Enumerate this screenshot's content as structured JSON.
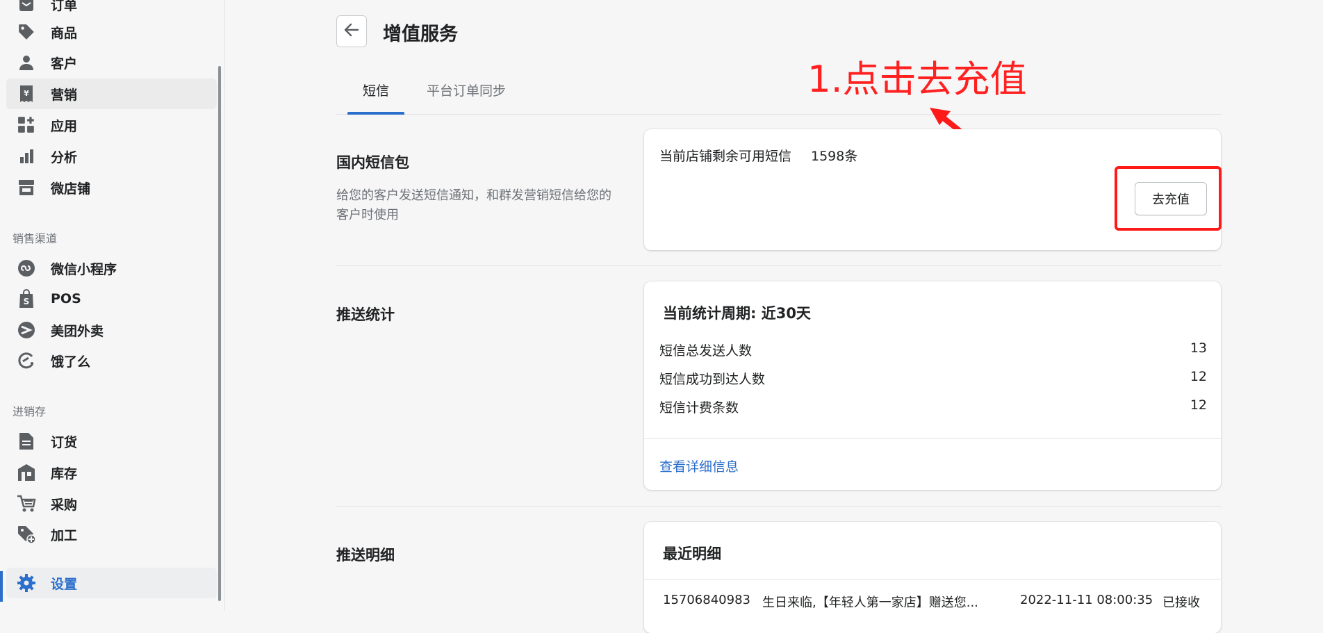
{
  "sidebar": {
    "items": [
      {
        "label": "订单",
        "icon": "order-icon"
      },
      {
        "label": "商品",
        "icon": "tag-icon"
      },
      {
        "label": "客户",
        "icon": "person-icon"
      },
      {
        "label": "营销",
        "icon": "marketing-icon"
      },
      {
        "label": "应用",
        "icon": "apps-icon"
      },
      {
        "label": "分析",
        "icon": "bar-chart-icon"
      },
      {
        "label": "微店铺",
        "icon": "store-icon"
      }
    ],
    "channels_title": "销售渠道",
    "channels": [
      {
        "label": "微信小程序",
        "icon": "mini-program-icon"
      },
      {
        "label": "POS",
        "icon": "pos-bag-icon"
      },
      {
        "label": "美团外卖",
        "icon": "meituan-icon"
      },
      {
        "label": "饿了么",
        "icon": "eleme-icon"
      }
    ],
    "inventory_title": "进销存",
    "inventory": [
      {
        "label": "订货",
        "icon": "document-icon"
      },
      {
        "label": "库存",
        "icon": "warehouse-icon"
      },
      {
        "label": "采购",
        "icon": "cart-icon"
      },
      {
        "label": "加工",
        "icon": "tag-plus-icon"
      }
    ],
    "settings": {
      "label": "设置",
      "icon": "gear-icon"
    }
  },
  "header": {
    "title": "增值服务"
  },
  "tabs": [
    {
      "label": "短信"
    },
    {
      "label": "平台订单同步"
    }
  ],
  "annotation": {
    "text": "1.点击去充值",
    "color": "#ff2020"
  },
  "sms_package": {
    "title": "国内短信包",
    "description": "给您的客户发送短信通知，和群发营销短信给您的客户时使用",
    "remaining_label": "当前店铺剩余可用短信",
    "remaining_value": "1598条",
    "recharge_label": "去充值"
  },
  "push_stats": {
    "title": "推送统计",
    "period": "当前统计周期: 近30天",
    "rows": [
      {
        "label": "短信总发送人数",
        "value": "13"
      },
      {
        "label": "短信成功到达人数",
        "value": "12"
      },
      {
        "label": "短信计费条数",
        "value": "12"
      }
    ],
    "detail_link": "查看详细信息"
  },
  "push_detail": {
    "title": "推送明细",
    "recent_title": "最近明细",
    "rows": [
      {
        "phone": "15706840983",
        "content": "生日来临,【年轻人第一家店】赠送您...",
        "time": "2022-11-11 08:00:35",
        "status": "已接收"
      }
    ]
  },
  "colors": {
    "accent": "#2c6ecb",
    "annotation": "#ff1a1a"
  }
}
